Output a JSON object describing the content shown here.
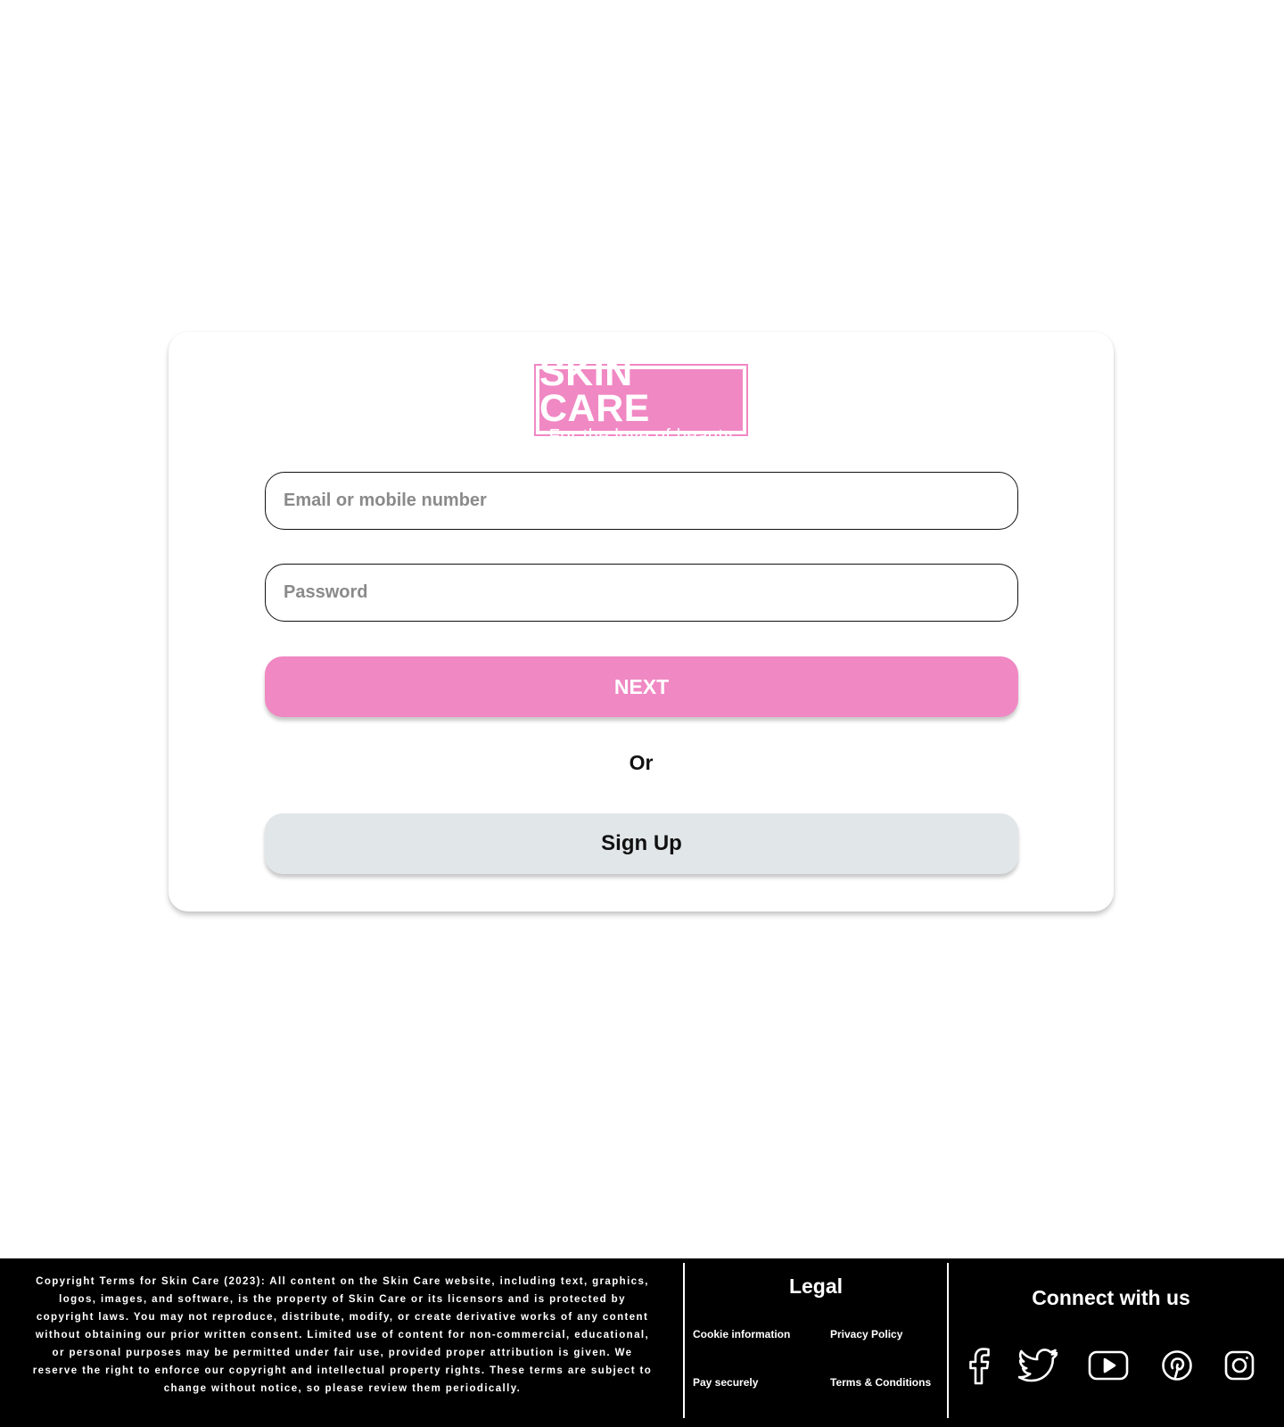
{
  "brand": {
    "name": "SKIN CARE",
    "tagline": "For the love of beauty",
    "accent_color": "#f088c3"
  },
  "login": {
    "email_placeholder": "Email or mobile number",
    "email_value": "",
    "password_placeholder": "Password",
    "password_value": "",
    "next_label": "NEXT",
    "or_label": "Or",
    "signup_label": "Sign Up"
  },
  "footer": {
    "copyright": "Copyright Terms for Skin Care (2023): All content on the Skin Care website, including text, graphics, logos, images, and software, is the property of Skin Care or its licensors and is protected by copyright laws. You may not reproduce, distribute, modify, or create derivative works of any content without obtaining our prior written consent. Limited use of content for non-commercial, educational, or personal purposes may be permitted under fair use, provided proper attribution is given. We reserve the right to enforce our copyright and intellectual property rights. These terms are subject to change without notice, so please review them periodically.",
    "legal": {
      "title": "Legal",
      "links": [
        "Cookie information",
        "Privacy  Policy",
        "Pay securely",
        "Terms & Conditions"
      ]
    },
    "connect": {
      "title": "Connect with us",
      "icons": [
        "facebook-icon",
        "twitter-icon",
        "youtube-icon",
        "pinterest-icon",
        "instagram-icon"
      ]
    }
  }
}
